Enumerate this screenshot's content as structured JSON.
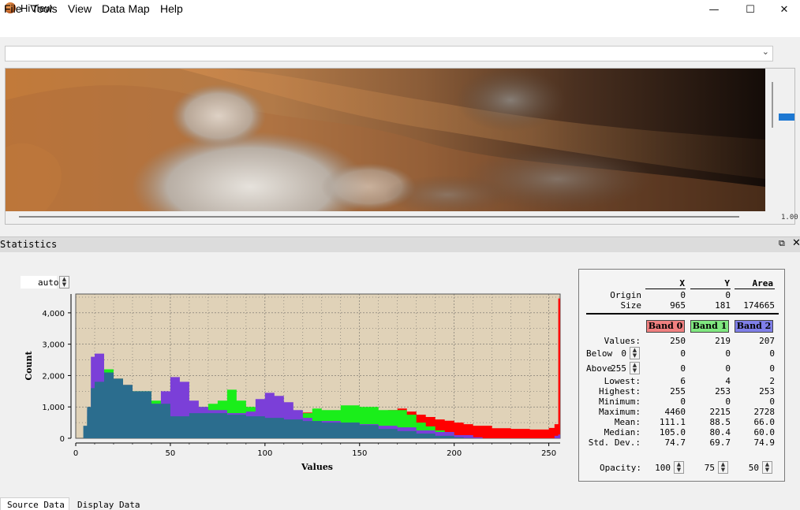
{
  "window": {
    "title": "HiView",
    "min_glyph": "—",
    "max_glyph": "☐",
    "close_glyph": "✕"
  },
  "menu": [
    {
      "label": "File"
    },
    {
      "label": "Tools"
    },
    {
      "label": "View"
    },
    {
      "label": "Data Map"
    },
    {
      "label": "Help"
    }
  ],
  "source_combo": {
    "value": "",
    "arrow": "⌄"
  },
  "image": {
    "zoom_label": "1.00"
  },
  "statistics": {
    "title": "Statistics",
    "undock_glyph": "⧉",
    "close_glyph": "✕",
    "auto_value": "auto",
    "area": {
      "headers": [
        "X",
        "Y",
        "Area"
      ],
      "origin_label": "Origin",
      "origin": [
        "0",
        "0",
        ""
      ],
      "size_label": "Size",
      "size": [
        "965",
        "181",
        "174665"
      ]
    },
    "bands": [
      {
        "label": "Band 0",
        "color": "#f08080"
      },
      {
        "label": "Band 1",
        "color": "#80e880"
      },
      {
        "label": "Band 2",
        "color": "#7f7fe8"
      }
    ],
    "rows": [
      {
        "label": "Values:",
        "vals": [
          "250",
          "219",
          "207"
        ]
      },
      {
        "label": "Below",
        "spin": "0",
        "vals": [
          "0",
          "0",
          "0"
        ]
      },
      {
        "label": "Above",
        "spin": "255",
        "vals": [
          "0",
          "0",
          "0"
        ]
      },
      {
        "label": "Lowest:",
        "vals": [
          "6",
          "4",
          "2"
        ]
      },
      {
        "label": "Highest:",
        "vals": [
          "255",
          "253",
          "253"
        ]
      },
      {
        "label": "Minimum:",
        "vals": [
          "0",
          "0",
          "0"
        ]
      },
      {
        "label": "Maximum:",
        "vals": [
          "4460",
          "2215",
          "2728"
        ]
      },
      {
        "label": "Mean:",
        "vals": [
          "111.1",
          "88.5",
          "66.0"
        ]
      },
      {
        "label": "Median:",
        "vals": [
          "105.0",
          "80.4",
          "60.0"
        ]
      },
      {
        "label": "Std. Dev.:",
        "vals": [
          "74.7",
          "69.7",
          "74.9"
        ]
      }
    ],
    "opacity_label": "Opacity:",
    "opacity": [
      "100",
      "75",
      "50"
    ]
  },
  "chart_data": {
    "type": "area",
    "xlabel": "Values",
    "ylabel": "Count",
    "xlim": [
      0,
      256
    ],
    "ylim": [
      0,
      4600
    ],
    "xticks": [
      0,
      50,
      100,
      150,
      200,
      250
    ],
    "yticks": [
      0,
      1000,
      2000,
      3000,
      4000
    ],
    "ytick_labels": [
      "0",
      "1,000",
      "2,000",
      "3,000",
      "4,000"
    ],
    "grid": true,
    "background": "#e0d2b8",
    "series": [
      {
        "color": "#ff0000",
        "x": [
          5,
          7,
          10,
          15,
          20,
          25,
          30,
          40,
          50,
          60,
          70,
          80,
          90,
          100,
          110,
          120,
          130,
          140,
          150,
          160,
          165,
          170,
          175,
          180,
          185,
          190,
          195,
          200,
          205,
          210,
          220,
          230,
          240,
          250,
          253,
          255,
          256
        ],
        "y": [
          0,
          600,
          1800,
          2100,
          1900,
          1700,
          1450,
          1100,
          900,
          950,
          1000,
          1050,
          900,
          820,
          800,
          820,
          850,
          850,
          850,
          820,
          900,
          950,
          850,
          750,
          680,
          600,
          560,
          500,
          450,
          400,
          320,
          300,
          280,
          330,
          450,
          4460,
          0
        ]
      },
      {
        "color": "#1aee1a",
        "x": [
          4,
          6,
          10,
          15,
          20,
          25,
          30,
          40,
          50,
          60,
          70,
          75,
          80,
          85,
          90,
          100,
          110,
          120,
          125,
          130,
          140,
          145,
          150,
          155,
          160,
          165,
          170,
          175,
          180,
          185,
          190,
          195,
          200,
          210,
          215,
          220
        ],
        "y": [
          0,
          700,
          1900,
          2200,
          1900,
          1700,
          1500,
          1200,
          950,
          1000,
          1100,
          1200,
          1550,
          1200,
          1000,
          850,
          750,
          800,
          950,
          900,
          1050,
          1050,
          1000,
          1000,
          900,
          900,
          900,
          750,
          500,
          380,
          250,
          150,
          80,
          20,
          0,
          0
        ]
      },
      {
        "color": "#7b3fd8",
        "x": [
          3,
          6,
          8,
          10,
          15,
          20,
          25,
          30,
          35,
          40,
          45,
          50,
          55,
          60,
          65,
          70,
          80,
          90,
          95,
          100,
          105,
          110,
          115,
          120,
          125,
          130,
          140,
          150,
          160,
          170,
          180,
          190,
          200,
          210,
          215,
          250,
          253,
          255,
          256
        ],
        "y": [
          0,
          900,
          2600,
          2700,
          2100,
          1800,
          1700,
          1400,
          1150,
          1100,
          1500,
          1950,
          1800,
          1200,
          1000,
          900,
          800,
          850,
          1250,
          1450,
          1350,
          1150,
          900,
          650,
          550,
          550,
          500,
          450,
          400,
          350,
          250,
          200,
          100,
          30,
          0,
          0,
          80,
          120,
          0
        ]
      },
      {
        "color": "#2b6d8e",
        "x": [
          2,
          4,
          6,
          8,
          10,
          15,
          20,
          25,
          30,
          40,
          50,
          60,
          70,
          80,
          90,
          100,
          110,
          120,
          130,
          140,
          150,
          160,
          170,
          180,
          190,
          200,
          205,
          210,
          255
        ],
        "y": [
          0,
          400,
          1000,
          1600,
          1800,
          2100,
          1900,
          1700,
          1500,
          1100,
          700,
          800,
          800,
          750,
          700,
          650,
          600,
          550,
          500,
          500,
          420,
          300,
          230,
          150,
          80,
          30,
          10,
          0,
          0
        ]
      }
    ]
  },
  "tabs": [
    {
      "label": "Source Data"
    },
    {
      "label": "Display Data"
    }
  ]
}
